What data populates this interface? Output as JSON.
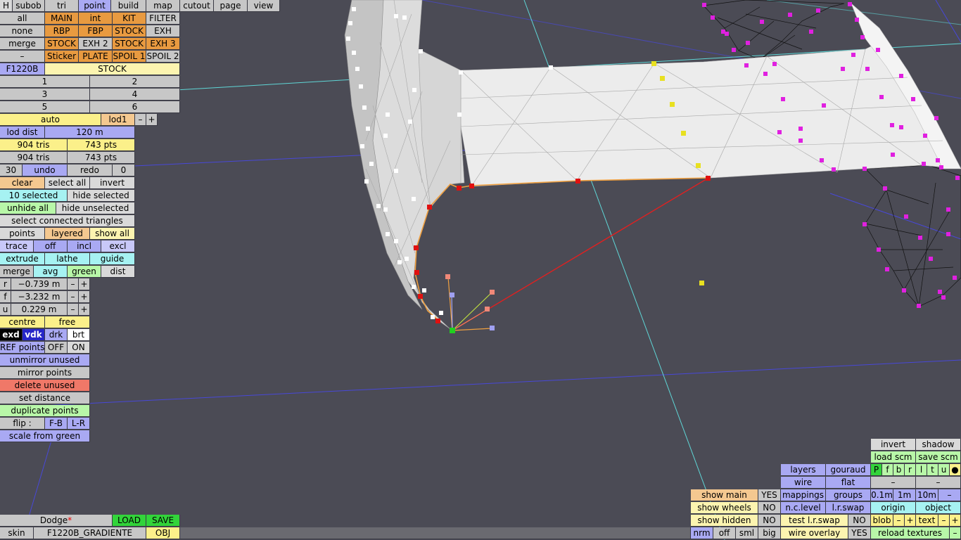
{
  "menu": [
    "H",
    "subob",
    "tri",
    "point",
    "build",
    "map",
    "cutout",
    "page",
    "view"
  ],
  "sel_rows": [
    [
      "all",
      "MAIN",
      "int",
      "KIT",
      "FILTER"
    ],
    [
      "none",
      "RBP",
      "FBP",
      "STOCK",
      "EXH"
    ],
    [
      "merge",
      "STOCK",
      "EXH 2",
      "STOCK",
      "EXH 3"
    ],
    [
      "–",
      "Sticker",
      "PLATE",
      "SPOIL 1",
      "SPOIL 2"
    ]
  ],
  "model_code": "F1220B",
  "part_name": "STOCK",
  "num_buttons": [
    "1",
    "2",
    "3",
    "4",
    "5",
    "6"
  ],
  "lod": {
    "auto": "auto",
    "lod1": "lod1",
    "minus": "–",
    "plus": "+",
    "dist_label": "lod dist",
    "dist_value": "120 m"
  },
  "counts": {
    "tris1": "904 tris",
    "pts1": "743 pts",
    "tris2": "904 tris",
    "pts2": "743 pts"
  },
  "undo": {
    "num": "30",
    "undo": "undo",
    "redo": "redo",
    "zero": "0"
  },
  "selection": {
    "clear": "clear",
    "select_all": "select all",
    "invert": "invert",
    "selected": "10 selected",
    "hide_selected": "hide selected",
    "unhide_all": "unhide all",
    "hide_unselected": "hide unselected",
    "select_connected": "select connected triangles"
  },
  "points_row": [
    "points",
    "layered",
    "show all"
  ],
  "trace_row": [
    "trace",
    "off",
    "incl",
    "excl"
  ],
  "extrude_row": [
    "extrude",
    "lathe",
    "guide"
  ],
  "merge_row": [
    "merge",
    "avg",
    "green",
    "dist"
  ],
  "coords": [
    {
      "axis": "r",
      "value": "−0.739 m"
    },
    {
      "axis": "f",
      "value": "−3.232 m"
    },
    {
      "axis": "u",
      "value": "0.229 m"
    }
  ],
  "centre_row": [
    "centre",
    "free"
  ],
  "shade_row": [
    "exd",
    "vdk",
    "drk",
    "brt"
  ],
  "ref_row": [
    "REF points",
    "OFF",
    "ON"
  ],
  "actions": [
    "unmirror unused",
    "mirror points",
    "delete unused",
    "set distance",
    "duplicate points"
  ],
  "flip_row": [
    "flip :",
    "F-B",
    "L-R"
  ],
  "scale_from_green": "scale from green",
  "bottom_left": {
    "car": "Dodge",
    "star": "*",
    "load": "LOAD",
    "save": "SAVE",
    "skin": "skin",
    "skin_name": "F1220B_GRADIENTE",
    "obj": "OBJ"
  },
  "bottom_right": {
    "show_main": "show main",
    "show_main_val": "YES",
    "show_wheels": "show wheels",
    "show_wheels_val": "NO",
    "show_hidden": "show hidden",
    "show_hidden_val": "NO",
    "sizes": [
      "nrm",
      "off",
      "sml",
      "big"
    ],
    "layers": "layers",
    "gouraud": "gouraud",
    "wire": "wire",
    "flat": "flat",
    "mappings": "mappings",
    "groups": "groups",
    "nclevel": "n.c.level",
    "lrswap": "l.r.swap",
    "test_lrswap": "test l.r.swap",
    "test_lrswap_val": "NO",
    "wire_overlay": "wire overlay",
    "wire_overlay_val": "YES",
    "invert": "invert",
    "shadow": "shadow",
    "load_scm": "load scm",
    "save_scm": "save scm",
    "flags": [
      "P",
      "f",
      "b",
      "r",
      "l",
      "t",
      "u",
      "●"
    ],
    "dash1": "–",
    "dash2": "–",
    "dist_01": "0.1m",
    "dist_1": "1m",
    "dist_10": "10m",
    "dist_minus": "–",
    "origin": "origin",
    "object": "object",
    "blob": "blob",
    "blob_minus": "–",
    "blob_plus": "+",
    "text": "text",
    "text_minus": "–",
    "text_plus": "+",
    "reload": "reload textures",
    "reload_minus": "–"
  },
  "colors": {
    "viewport_bg": "#4b4b55",
    "grid_cyan": "#5fd6d6",
    "grid_blue": "#4848d8",
    "selected_point": "#e01010",
    "green_point": "#20d020",
    "magenta_point": "#e020e0",
    "yellow_point": "#e8e020"
  }
}
